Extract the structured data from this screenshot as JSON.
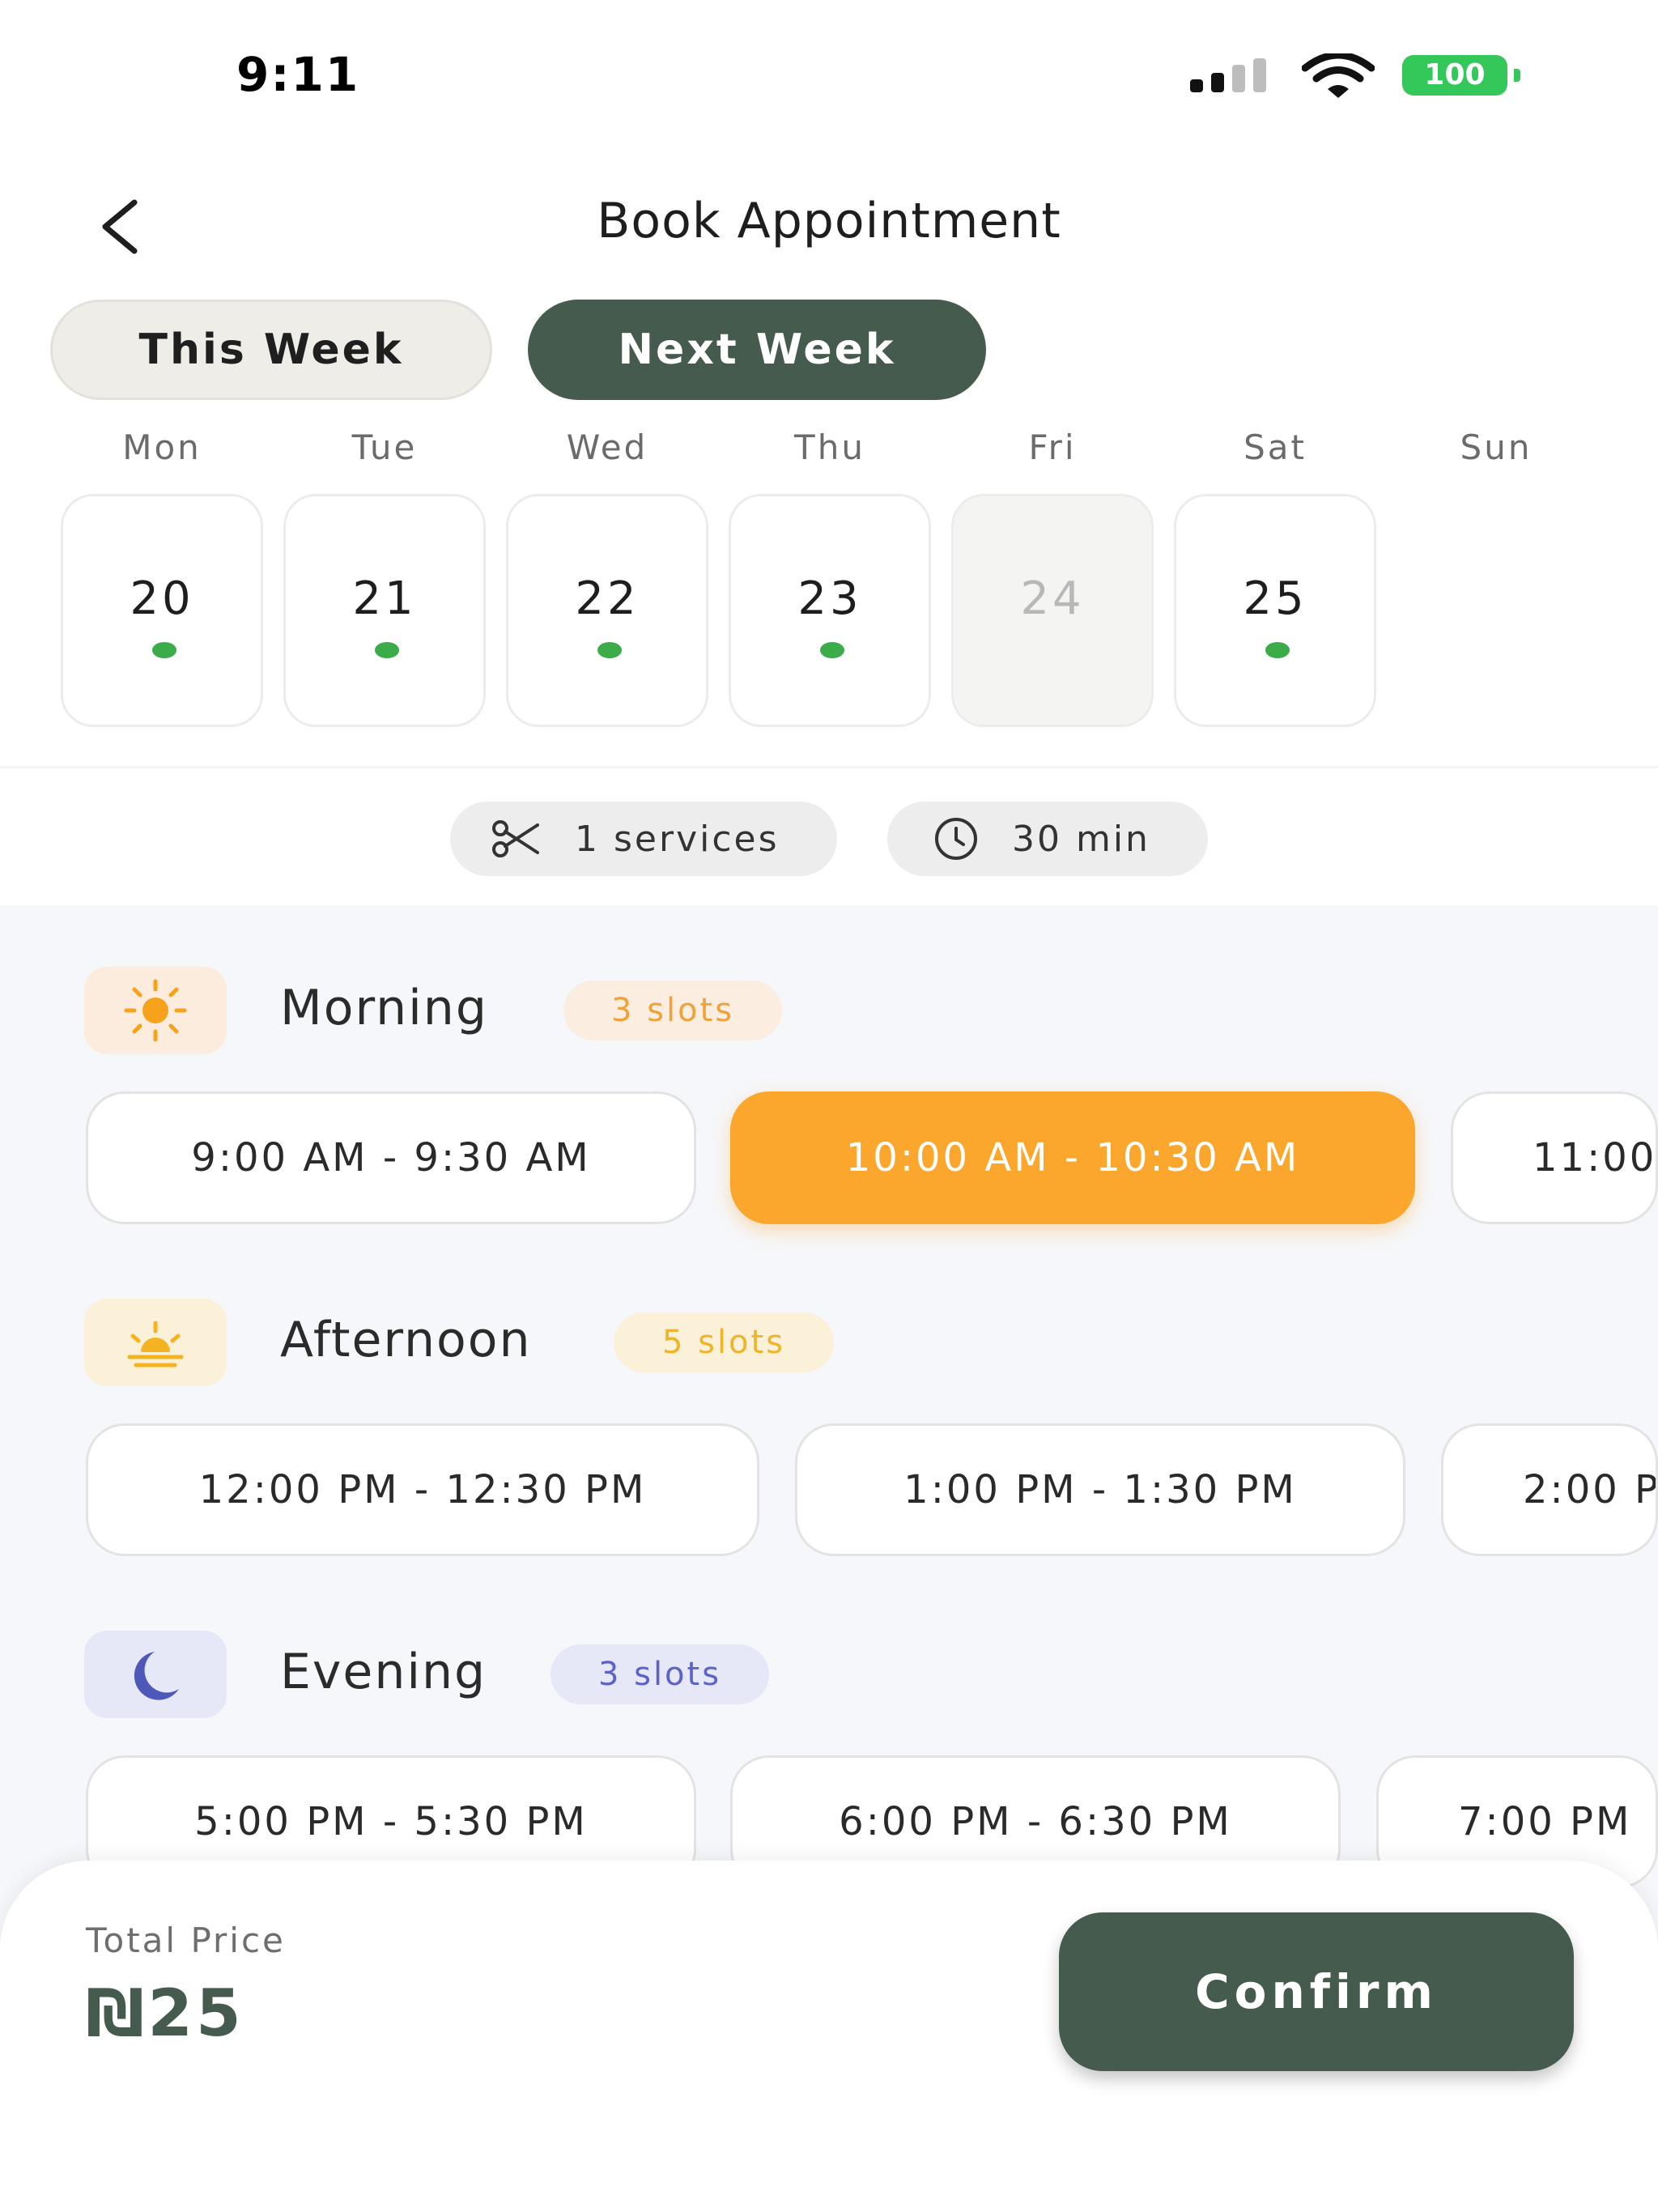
{
  "status_bar": {
    "time": "9:11",
    "battery": "100"
  },
  "header": {
    "title": "Book Appointment"
  },
  "week_toggle": {
    "this_week": "This Week",
    "next_week": "Next Week",
    "selected": "Next Week"
  },
  "days": [
    {
      "name": "Mon",
      "date": "20",
      "available": true
    },
    {
      "name": "Tue",
      "date": "21",
      "available": true
    },
    {
      "name": "Wed",
      "date": "22",
      "available": true
    },
    {
      "name": "Thu",
      "date": "23",
      "available": true
    },
    {
      "name": "Fri",
      "date": "24",
      "available": false
    },
    {
      "name": "Sat",
      "date": "25",
      "available": true
    },
    {
      "name": "Sun",
      "date": "",
      "available": false
    }
  ],
  "summary": {
    "services": "1 services",
    "duration": "30 min"
  },
  "sections": {
    "morning": {
      "title": "Morning",
      "badge": "3 slots",
      "icon": "sun-icon",
      "slots": [
        "9:00 AM - 9:30 AM",
        "10:00 AM - 10:30 AM",
        "11:00"
      ],
      "selected_index": 1
    },
    "afternoon": {
      "title": "Afternoon",
      "badge": "5 slots",
      "icon": "sunset-icon",
      "slots": [
        "12:00 PM - 12:30 PM",
        "1:00 PM - 1:30 PM",
        "2:00 P"
      ]
    },
    "evening": {
      "title": "Evening",
      "badge": "3 slots",
      "icon": "moon-icon",
      "slots": [
        "5:00 PM - 5:30 PM",
        "6:00 PM - 6:30 PM",
        "7:00 PM"
      ]
    }
  },
  "footer": {
    "price_label": "Total Price",
    "price": "₪25",
    "confirm": "Confirm"
  },
  "colors": {
    "primary": "#455b4e",
    "selected_slot": "#fba62c",
    "available_dot": "#3cab4a",
    "morning_badge_bg": "#fbeee0",
    "morning_badge_text": "#f0a23a",
    "afternoon_badge_bg": "#fbf0d8",
    "afternoon_badge_text": "#eeb42a",
    "evening_badge_bg": "#e6e8f8",
    "evening_badge_text": "#5b63c8"
  }
}
